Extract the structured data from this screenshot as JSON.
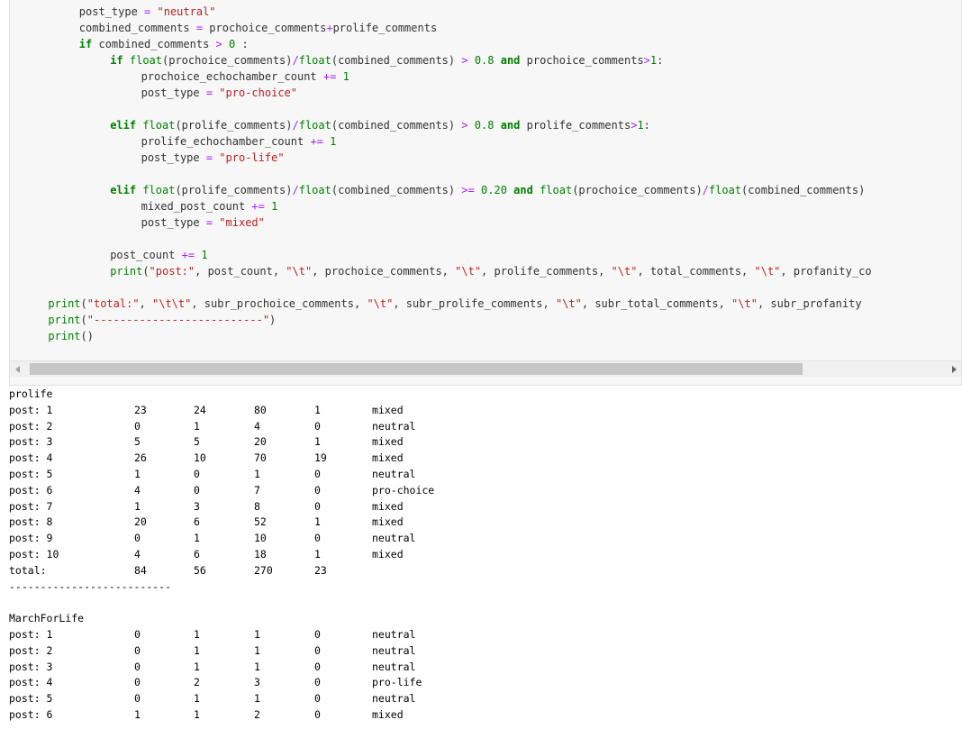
{
  "code_lines": [
    {
      "indent": 8,
      "tokens": [
        [
          "n",
          "post_type "
        ],
        [
          "op",
          "= "
        ],
        [
          "s",
          "\"neutral\""
        ]
      ]
    },
    {
      "indent": 8,
      "tokens": [
        [
          "n",
          "combined_comments "
        ],
        [
          "op",
          "= "
        ],
        [
          "n",
          "prochoice_comments"
        ],
        [
          "op",
          "+"
        ],
        [
          "n",
          "prolife_comments"
        ]
      ]
    },
    {
      "indent": 8,
      "tokens": [
        [
          "k",
          "if "
        ],
        [
          "n",
          "combined_comments "
        ],
        [
          "op",
          "> "
        ],
        [
          "m",
          "0"
        ],
        [
          "n",
          " :"
        ]
      ]
    },
    {
      "indent": 12,
      "tokens": [
        [
          "k",
          "if "
        ],
        [
          "b",
          "float"
        ],
        [
          "n",
          "(prochoice_comments)"
        ],
        [
          "op",
          "/"
        ],
        [
          "b",
          "float"
        ],
        [
          "n",
          "(combined_comments) "
        ],
        [
          "op",
          "> "
        ],
        [
          "m",
          "0.8 "
        ],
        [
          "k",
          "and "
        ],
        [
          "n",
          "prochoice_comments"
        ],
        [
          "op",
          ">"
        ],
        [
          "m",
          "1"
        ],
        [
          "n",
          ":"
        ]
      ]
    },
    {
      "indent": 16,
      "tokens": [
        [
          "n",
          "prochoice_echochamber_count "
        ],
        [
          "op",
          "+= "
        ],
        [
          "m",
          "1"
        ]
      ]
    },
    {
      "indent": 16,
      "tokens": [
        [
          "n",
          "post_type "
        ],
        [
          "op",
          "= "
        ],
        [
          "s",
          "\"pro-choice\""
        ]
      ]
    },
    {
      "indent": 0,
      "tokens": []
    },
    {
      "indent": 12,
      "tokens": [
        [
          "k",
          "elif "
        ],
        [
          "b",
          "float"
        ],
        [
          "n",
          "(prolife_comments)"
        ],
        [
          "op",
          "/"
        ],
        [
          "b",
          "float"
        ],
        [
          "n",
          "(combined_comments) "
        ],
        [
          "op",
          "> "
        ],
        [
          "m",
          "0.8 "
        ],
        [
          "k",
          "and "
        ],
        [
          "n",
          "prolife_comments"
        ],
        [
          "op",
          ">"
        ],
        [
          "m",
          "1"
        ],
        [
          "n",
          ":"
        ]
      ]
    },
    {
      "indent": 16,
      "tokens": [
        [
          "n",
          "prolife_echochamber_count "
        ],
        [
          "op",
          "+= "
        ],
        [
          "m",
          "1"
        ]
      ]
    },
    {
      "indent": 16,
      "tokens": [
        [
          "n",
          "post_type "
        ],
        [
          "op",
          "= "
        ],
        [
          "s",
          "\"pro-life\""
        ]
      ]
    },
    {
      "indent": 0,
      "tokens": []
    },
    {
      "indent": 12,
      "tokens": [
        [
          "k",
          "elif "
        ],
        [
          "b",
          "float"
        ],
        [
          "n",
          "(prolife_comments)"
        ],
        [
          "op",
          "/"
        ],
        [
          "b",
          "float"
        ],
        [
          "n",
          "(combined_comments) "
        ],
        [
          "op",
          ">= "
        ],
        [
          "m",
          "0.20 "
        ],
        [
          "k",
          "and "
        ],
        [
          "b",
          "float"
        ],
        [
          "n",
          "(prochoice_comments)"
        ],
        [
          "op",
          "/"
        ],
        [
          "b",
          "float"
        ],
        [
          "n",
          "(combined_comments)"
        ]
      ]
    },
    {
      "indent": 16,
      "tokens": [
        [
          "n",
          "mixed_post_count "
        ],
        [
          "op",
          "+= "
        ],
        [
          "m",
          "1"
        ]
      ]
    },
    {
      "indent": 16,
      "tokens": [
        [
          "n",
          "post_type "
        ],
        [
          "op",
          "= "
        ],
        [
          "s",
          "\"mixed\""
        ]
      ]
    },
    {
      "indent": 0,
      "tokens": []
    },
    {
      "indent": 12,
      "tokens": [
        [
          "n",
          "post_count "
        ],
        [
          "op",
          "+= "
        ],
        [
          "m",
          "1"
        ]
      ]
    },
    {
      "indent": 12,
      "tokens": [
        [
          "b",
          "print"
        ],
        [
          "n",
          "("
        ],
        [
          "s",
          "\"post:\""
        ],
        [
          "n",
          ", post_count, "
        ],
        [
          "s",
          "\"\\t\""
        ],
        [
          "n",
          ", prochoice_comments, "
        ],
        [
          "s",
          "\"\\t\""
        ],
        [
          "n",
          ", prolife_comments, "
        ],
        [
          "s",
          "\"\\t\""
        ],
        [
          "n",
          ", total_comments, "
        ],
        [
          "s",
          "\"\\t\""
        ],
        [
          "n",
          ", profanity_co"
        ]
      ]
    },
    {
      "indent": 0,
      "tokens": []
    },
    {
      "indent": 4,
      "tokens": [
        [
          "b",
          "print"
        ],
        [
          "n",
          "("
        ],
        [
          "s",
          "\"total:\""
        ],
        [
          "n",
          ", "
        ],
        [
          "s",
          "\"\\t\\t\""
        ],
        [
          "n",
          ", subr_prochoice_comments, "
        ],
        [
          "s",
          "\"\\t\""
        ],
        [
          "n",
          ", subr_prolife_comments, "
        ],
        [
          "s",
          "\"\\t\""
        ],
        [
          "n",
          ", subr_total_comments, "
        ],
        [
          "s",
          "\"\\t\""
        ],
        [
          "n",
          ", subr_profanity"
        ]
      ]
    },
    {
      "indent": 4,
      "tokens": [
        [
          "b",
          "print"
        ],
        [
          "n",
          "("
        ],
        [
          "s",
          "\"--------------------------\""
        ],
        [
          "n",
          ")"
        ]
      ]
    },
    {
      "indent": 4,
      "tokens": [
        [
          "b",
          "print"
        ],
        [
          "n",
          "()"
        ]
      ]
    }
  ],
  "output": {
    "sections": [
      {
        "name": "prolife",
        "rows": [
          [
            "post: 1",
            "23",
            "24",
            "80",
            "1",
            "mixed"
          ],
          [
            "post: 2",
            "0",
            "1",
            "4",
            "0",
            "neutral"
          ],
          [
            "post: 3",
            "5",
            "5",
            "20",
            "1",
            "mixed"
          ],
          [
            "post: 4",
            "26",
            "10",
            "70",
            "19",
            "mixed"
          ],
          [
            "post: 5",
            "1",
            "0",
            "1",
            "0",
            "neutral"
          ],
          [
            "post: 6",
            "4",
            "0",
            "7",
            "0",
            "pro-choice"
          ],
          [
            "post: 7",
            "1",
            "3",
            "8",
            "0",
            "mixed"
          ],
          [
            "post: 8",
            "20",
            "6",
            "52",
            "1",
            "mixed"
          ],
          [
            "post: 9",
            "0",
            "1",
            "10",
            "0",
            "neutral"
          ],
          [
            "post: 10",
            "4",
            "6",
            "18",
            "1",
            "mixed"
          ]
        ],
        "total": [
          "total:",
          "84",
          "56",
          "270",
          "23",
          ""
        ],
        "separator": "--------------------------"
      },
      {
        "name": "MarchForLife",
        "rows": [
          [
            "post: 1",
            "0",
            "1",
            "1",
            "0",
            "neutral"
          ],
          [
            "post: 2",
            "0",
            "1",
            "1",
            "0",
            "neutral"
          ],
          [
            "post: 3",
            "0",
            "1",
            "1",
            "0",
            "neutral"
          ],
          [
            "post: 4",
            "0",
            "2",
            "3",
            "0",
            "pro-life"
          ],
          [
            "post: 5",
            "0",
            "1",
            "1",
            "0",
            "neutral"
          ],
          [
            "post: 6",
            "1",
            "1",
            "2",
            "0",
            "mixed"
          ]
        ]
      }
    ]
  }
}
